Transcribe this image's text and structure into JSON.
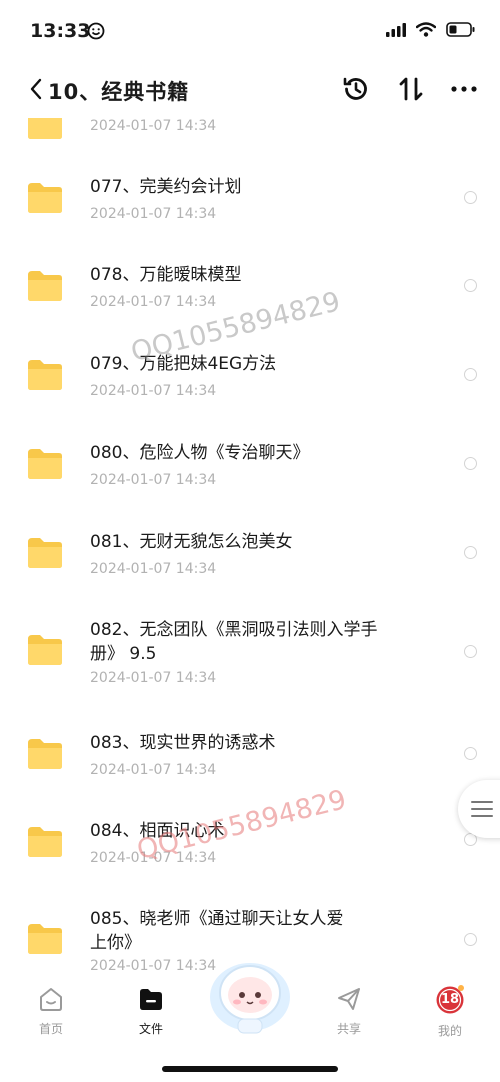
{
  "status_bar": {
    "time": "13:33"
  },
  "header": {
    "title": "10、经典书籍"
  },
  "files": [
    {
      "name": "",
      "date": "2024-01-07 14:34"
    },
    {
      "name": "077、完美约会计划",
      "date": "2024-01-07 14:34"
    },
    {
      "name": "078、万能暧昧模型",
      "date": "2024-01-07 14:34"
    },
    {
      "name": "079、万能把妹4EG方法",
      "date": "2024-01-07 14:34"
    },
    {
      "name": "080、危险人物《专治聊天》",
      "date": "2024-01-07 14:34"
    },
    {
      "name": "081、无财无貌怎么泡美女",
      "date": "2024-01-07 14:34"
    },
    {
      "name": "082、无念团队《黑洞吸引法则入学手册》 9.5",
      "date": "2024-01-07 14:34"
    },
    {
      "name": "083、现实世界的诱惑术",
      "date": "2024-01-07 14:34"
    },
    {
      "name": "084、相面识心术",
      "date": "2024-01-07 14:34"
    },
    {
      "name": "085、晓老师《通过聊天让女人爱上你》",
      "date": "2024-01-07 14:34"
    }
  ],
  "watermarks": [
    "QQ1055894829",
    "QQ1055894829"
  ],
  "tabs": [
    {
      "label": "首页",
      "icon": "home-icon"
    },
    {
      "label": "文件",
      "icon": "folder-icon"
    },
    {
      "label": "共享",
      "icon": "share-icon"
    },
    {
      "label": "我的",
      "icon": "profile-icon",
      "badge": "18"
    }
  ],
  "colors": {
    "folder": "#f8c84a",
    "date": "#b2b2b2",
    "text": "#1b1b1b"
  }
}
